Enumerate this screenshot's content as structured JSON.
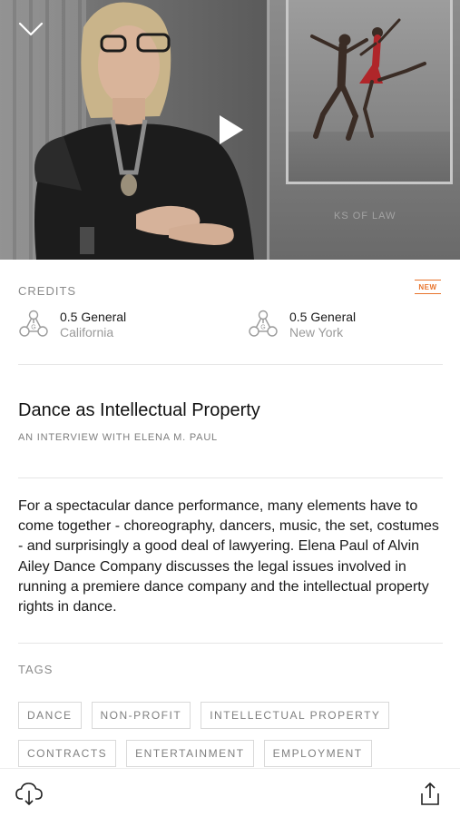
{
  "video": {
    "watermark_text": "KS OF LAW",
    "collapse_icon": "chevron-down-icon",
    "play_icon": "play-icon"
  },
  "credits": {
    "label": "CREDITS",
    "badge": "NEW",
    "badge_color": "#e8742c",
    "items": [
      {
        "amount": "0.5 General",
        "state": "California",
        "icon": "general-credit-icon"
      },
      {
        "amount": "0.5 General",
        "state": "New York",
        "icon": "general-credit-icon"
      }
    ]
  },
  "course": {
    "title": "Dance as Intellectual Property",
    "subtitle": "AN INTERVIEW WITH ELENA M. PAUL",
    "description": "For a spectacular dance performance, many elements have to come together - choreography, dancers, music, the set, costumes - and surprisingly a good deal of lawyering. Elena Paul of Alvin Ailey Dance Company discusses the legal issues involved in running a premiere dance company and the intellectual property rights in dance."
  },
  "tags": {
    "label": "TAGS",
    "items": [
      "DANCE",
      "NON-PROFIT",
      "INTELLECTUAL PROPERTY",
      "CONTRACTS",
      "ENTERTAINMENT",
      "EMPLOYMENT"
    ]
  },
  "toolbar": {
    "download_icon": "cloud-download-icon",
    "share_icon": "share-icon"
  }
}
